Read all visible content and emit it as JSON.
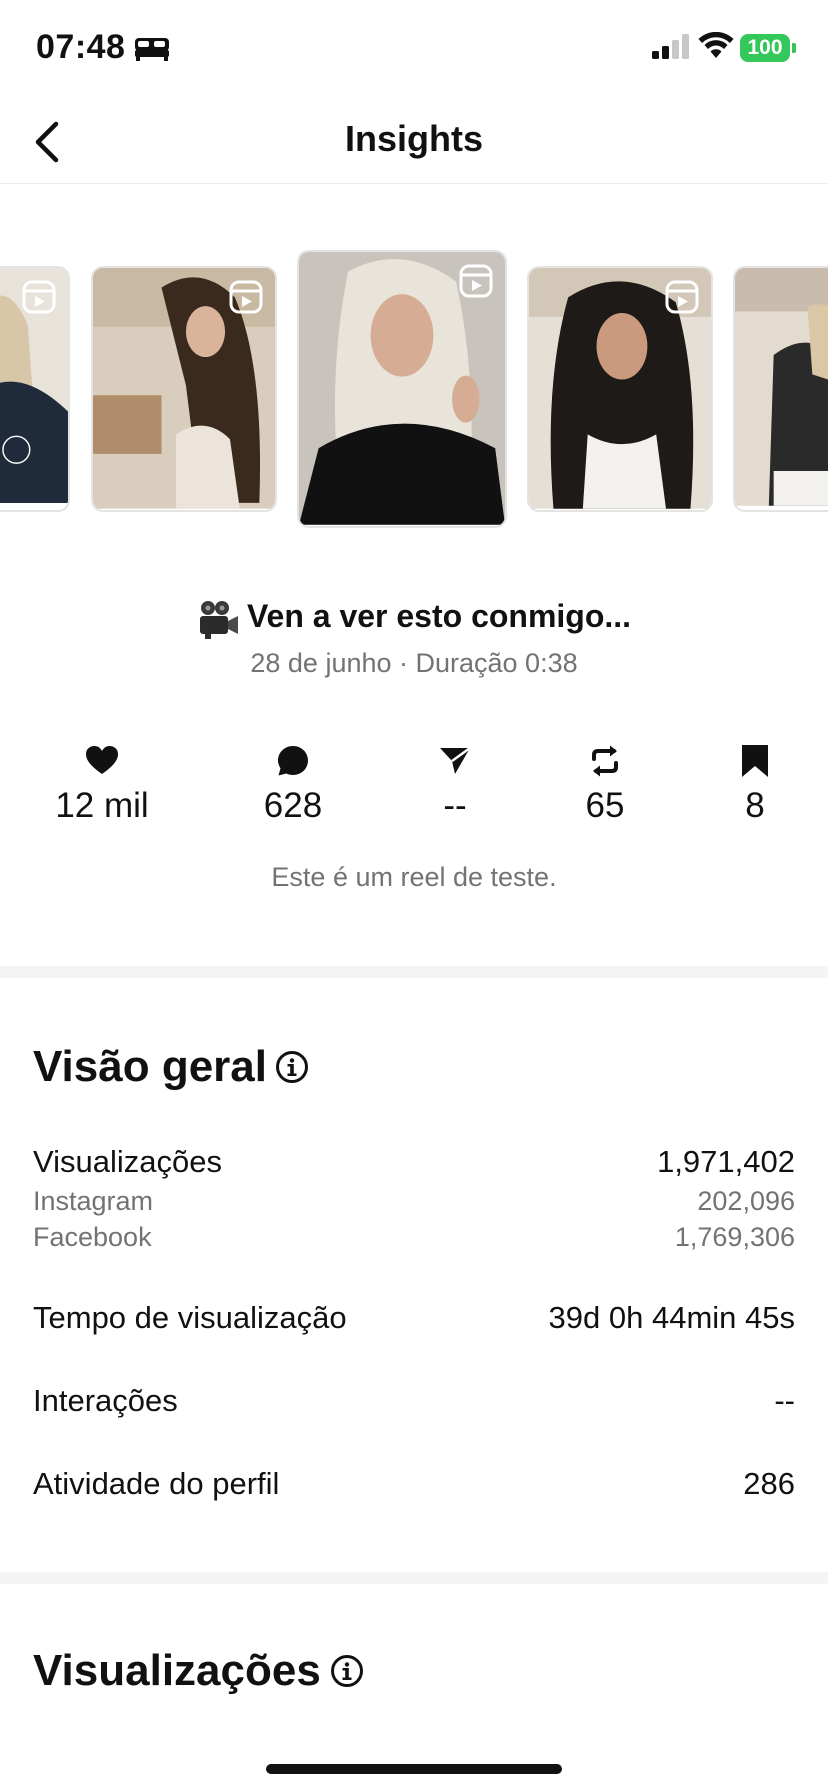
{
  "status_bar": {
    "time": "07:48",
    "battery": "100",
    "battery_color": "#34c759"
  },
  "nav": {
    "title": "Insights"
  },
  "carousel": {
    "items": [
      {
        "label": "reel-thumbnail-1",
        "bg": "#2f3a4a",
        "accent": "#d8c6a8"
      },
      {
        "label": "reel-thumbnail-2",
        "bg": "#b7a792",
        "accent": "#3a2a1e"
      },
      {
        "label": "reel-thumbnail-3",
        "bg": "#cfcac3",
        "accent": "#e6e2da"
      },
      {
        "label": "reel-thumbnail-4",
        "bg": "#d9d2c8",
        "accent": "#1e1a18"
      },
      {
        "label": "reel-thumbnail-5",
        "bg": "#c9bcae",
        "accent": "#2a2a2a"
      }
    ]
  },
  "post": {
    "title": "Ven a ver esto conmigo...",
    "meta": "28 de junho · Duração 0:38",
    "caption": "Este é um reel de teste."
  },
  "stats": {
    "likes": "12 mil",
    "comments": "628",
    "shares": "--",
    "reposts": "65",
    "saves": "8"
  },
  "overview": {
    "title": "Visão geral",
    "views_label": "Visualizações",
    "views_value": "1,971,402",
    "instagram_label": "Instagram",
    "instagram_value": "202,096",
    "facebook_label": "Facebook",
    "facebook_value": "1,769,306",
    "watch_time_label": "Tempo de visualização",
    "watch_time_value": "39d 0h 44min 45s",
    "interactions_label": "Interações",
    "interactions_value": "--",
    "profile_activity_label": "Atividade do perfil",
    "profile_activity_value": "286"
  },
  "views_section": {
    "title": "Visualizações"
  }
}
